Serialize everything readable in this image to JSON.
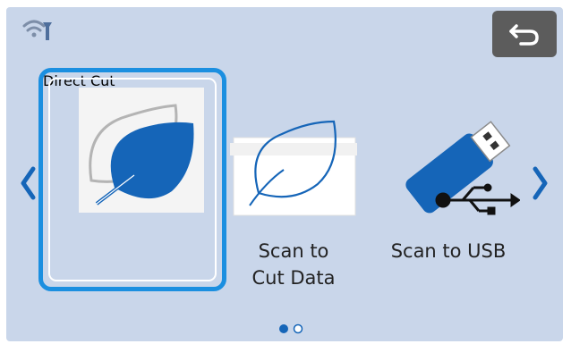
{
  "status_bar": {
    "wifi_icon": "wifi-settings-icon"
  },
  "back_button": {
    "icon": "back-arrow-icon"
  },
  "nav": {
    "prev_icon": "chevron-left-icon",
    "next_icon": "chevron-right-icon"
  },
  "items": [
    {
      "label": "Direct Cut",
      "icon": "leaf-direct-cut-icon",
      "selected": true
    },
    {
      "label": "Scan to\nCut Data",
      "icon": "leaf-scan-icon",
      "selected": false
    },
    {
      "label": "Scan to USB",
      "icon": "usb-drive-icon",
      "selected": false
    }
  ],
  "pagination": {
    "pages": 2,
    "current": 1
  },
  "colors": {
    "accent": "#1b8fe0",
    "icon_blue": "#1565b8",
    "background": "#c9d6ea"
  }
}
